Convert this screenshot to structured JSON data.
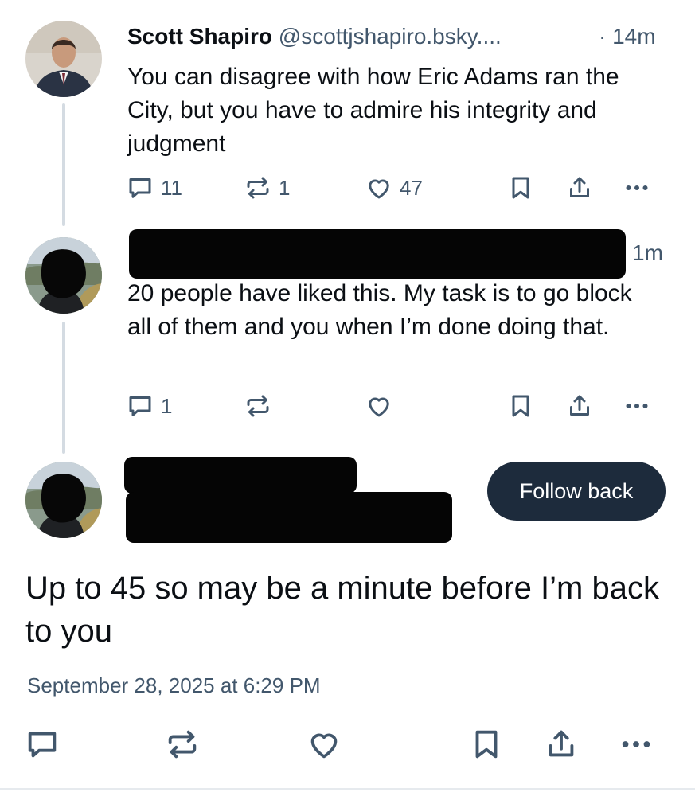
{
  "colors": {
    "text_primary": "#0b0f14",
    "text_muted": "#42576c",
    "thread_line": "#d4dbe2",
    "follow_button": "#1d2b3c",
    "redaction": "#050505"
  },
  "post1": {
    "author_name": "Scott Shapiro",
    "author_handle": "@scottjshapiro.bsky....",
    "time": "· 14m",
    "text": "You can disagree with how Eric Adams ran the City, but you have to admire his integrity and judgment",
    "replies": "11",
    "reposts": "1",
    "likes": "47"
  },
  "post2": {
    "time": "1m",
    "text": "20 people have liked this. My task is to go block all of them and you when I’m done doing that.",
    "replies": "1",
    "reposts": "",
    "likes": ""
  },
  "main_post": {
    "follow_button_label": "Follow back",
    "text": "Up to 45 so may be a minute before I’m back to you",
    "timestamp": "September 28, 2025 at 6:29 PM"
  },
  "icons": [
    "reply-icon",
    "repost-icon",
    "like-icon",
    "bookmark-icon",
    "share-icon",
    "more-icon"
  ]
}
